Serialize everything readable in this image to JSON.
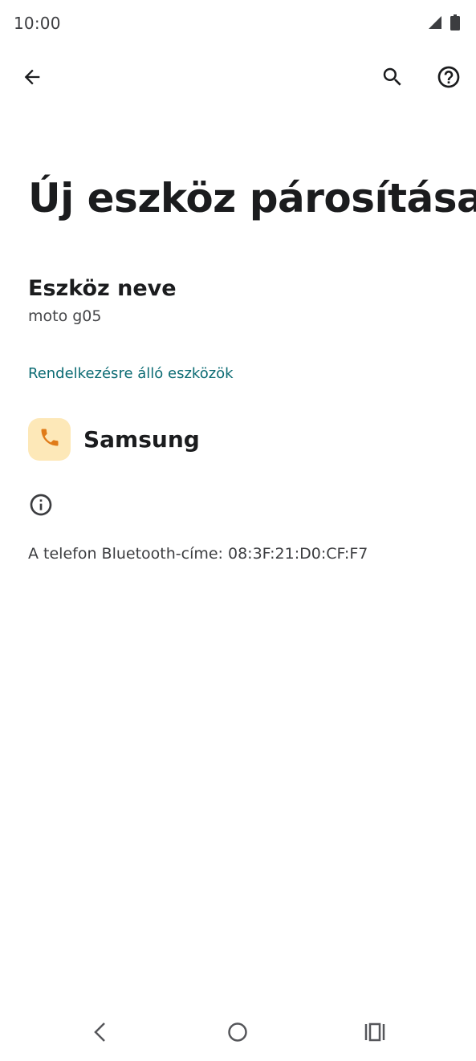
{
  "status_bar": {
    "time": "10:00",
    "icons": [
      "signal-icon",
      "battery-icon"
    ]
  },
  "app_bar": {
    "back_icon": "arrow-left-icon",
    "search_icon": "search-icon",
    "help_icon": "help-circle-icon"
  },
  "page": {
    "title": "Új eszköz párosítása"
  },
  "device_name": {
    "title": "Eszköz neve",
    "value": "moto g05"
  },
  "available_devices": {
    "header": "Rendelkezésre álló eszközök",
    "items": [
      {
        "label": "Samsung",
        "icon": "phone-icon"
      }
    ]
  },
  "info": {
    "icon": "info-icon",
    "bluetooth_address": "A telefon Bluetooth-címe: 08:3F:21:D0:CF:F7"
  },
  "nav_bar": {
    "back": "nav-back-icon",
    "home": "nav-home-icon",
    "recents": "nav-recents-icon"
  },
  "colors": {
    "accent": "#0b6b73",
    "device_icon_bg": "#fde8b8",
    "device_icon_fg": "#e07b18",
    "text_primary": "#1b1c1e",
    "text_secondary": "#46474a"
  }
}
